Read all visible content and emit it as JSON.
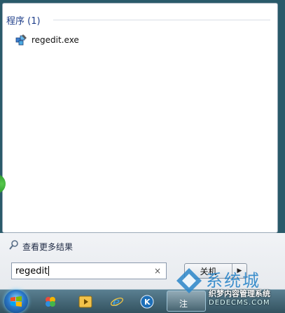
{
  "results": {
    "section_header": "程序 (1)",
    "items": [
      {
        "label": "regedit.exe"
      }
    ]
  },
  "see_more": {
    "label": "查看更多结果"
  },
  "search": {
    "value": "regedit",
    "clear_glyph": "×"
  },
  "shutdown": {
    "label": "关机",
    "arrow": "▶"
  },
  "taskbar": {
    "active_button_text": "注"
  },
  "watermark": {
    "big_text": "系统城",
    "line1": "织梦内容管理系统",
    "line2": "DEDECMS.COM"
  },
  "icons": {
    "app": "regedit-app-icon",
    "see_more": "search-icon",
    "start": "windows-start-icon"
  },
  "colors": {
    "header": "#1e3e8a",
    "taskbar_top": "#5a7f91",
    "taskbar_bottom": "#33525f"
  }
}
